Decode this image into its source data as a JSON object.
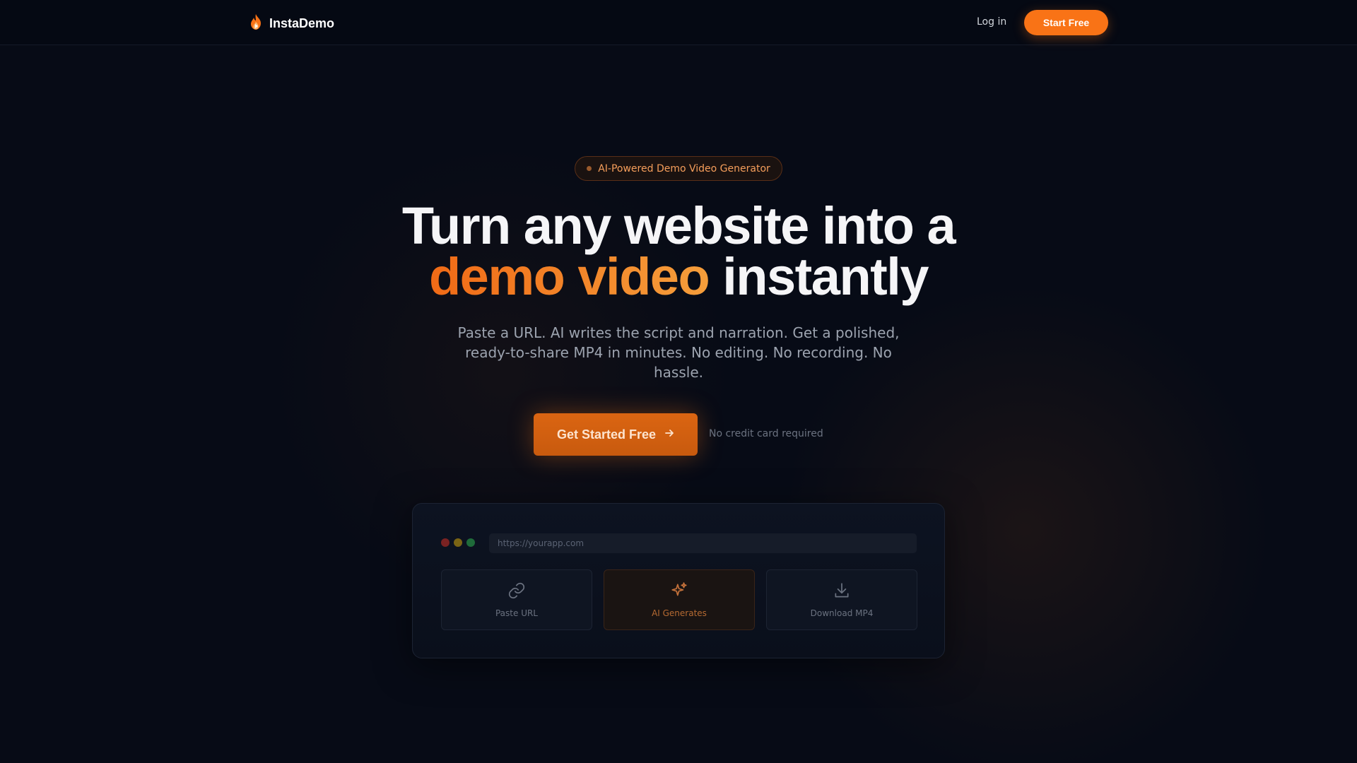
{
  "header": {
    "brand_name": "InstaDemo",
    "login_label": "Log in",
    "start_label": "Start Free"
  },
  "hero": {
    "badge_text": "AI-Powered Demo Video Generator",
    "headline_line1": "Turn any website into a",
    "headline_highlight": "demo video",
    "headline_rest": "instantly",
    "subtitle": "Paste a URL. AI writes the script and narration. Get a polished, ready-to-share MP4 in minutes. No editing. No recording. No hassle.",
    "cta_label": "Get Started Free",
    "cta_note": "No credit card required"
  },
  "preview": {
    "url_placeholder": "https://yourapp.com",
    "steps": [
      {
        "label": "Paste URL",
        "icon": "link-icon"
      },
      {
        "label": "AI Generates",
        "icon": "sparkles-icon"
      },
      {
        "label": "Download MP4",
        "icon": "download-icon"
      }
    ]
  },
  "colors": {
    "accent": "#f97316",
    "background": "#070b16",
    "text": "#f3f4f6",
    "muted": "#9ca3af"
  }
}
